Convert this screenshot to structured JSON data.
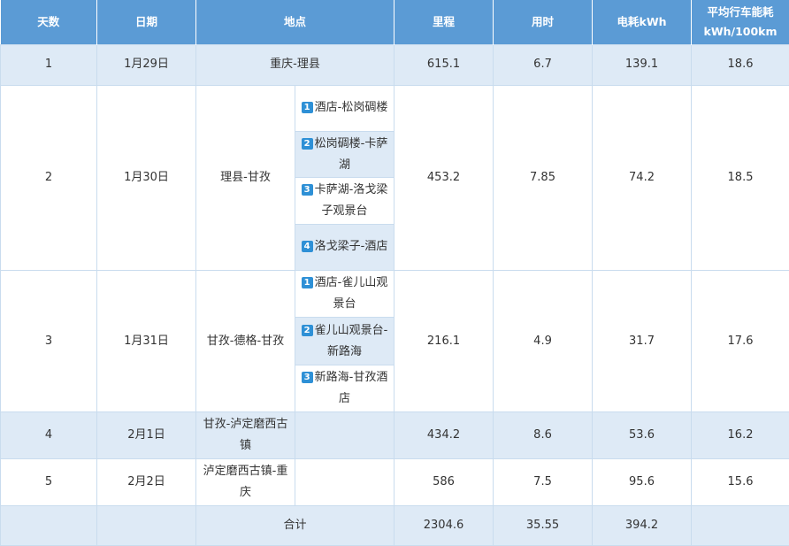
{
  "headers": [
    "天数",
    "日期",
    "地点",
    "里程",
    "用时",
    "电耗kWh",
    "平均行车能耗kWh/100km"
  ],
  "days": [
    {
      "day": "1",
      "date": "1月29日",
      "place": "重庆-理县",
      "stops": [],
      "mileage": "615.1",
      "hours": "6.7",
      "kwh": "139.1",
      "avg": "18.6"
    },
    {
      "day": "2",
      "date": "1月30日",
      "place": "理县-甘孜",
      "stops": [
        {
          "n": "1",
          "text": "酒店-松岗碉楼"
        },
        {
          "n": "2",
          "text": "松岗碉楼-卡萨湖"
        },
        {
          "n": "3",
          "text": "卡萨湖-洛戈梁子观景台"
        },
        {
          "n": "4",
          "text": "洛戈梁子-酒店"
        }
      ],
      "mileage": "453.2",
      "hours": "7.85",
      "kwh": "74.2",
      "avg": "18.5"
    },
    {
      "day": "3",
      "date": "1月31日",
      "place": "甘孜-德格-甘孜",
      "stops": [
        {
          "n": "1",
          "text": "酒店-雀儿山观景台"
        },
        {
          "n": "2",
          "text": "雀儿山观景台-新路海"
        },
        {
          "n": "3",
          "text": "新路海-甘孜酒店"
        }
      ],
      "mileage": "216.1",
      "hours": "4.9",
      "kwh": "31.7",
      "avg": "17.6"
    },
    {
      "day": "4",
      "date": "2月1日",
      "place": "甘孜-泸定磨西古镇",
      "stops": [],
      "mileage": "434.2",
      "hours": "8.6",
      "kwh": "53.6",
      "avg": "16.2"
    },
    {
      "day": "5",
      "date": "2月2日",
      "place": "泸定磨西古镇-重庆",
      "stops": [],
      "mileage": "586",
      "hours": "7.5",
      "kwh": "95.6",
      "avg": "15.6"
    }
  ],
  "total": {
    "label": "合计",
    "mileage": "2304.6",
    "hours": "35.55",
    "kwh": "394.2",
    "avg": ""
  },
  "colors": {
    "header_bg": "#5b9bd5",
    "row_shade": "#deeaf6",
    "badge": "#2e90d6",
    "border": "#c9dcee"
  }
}
